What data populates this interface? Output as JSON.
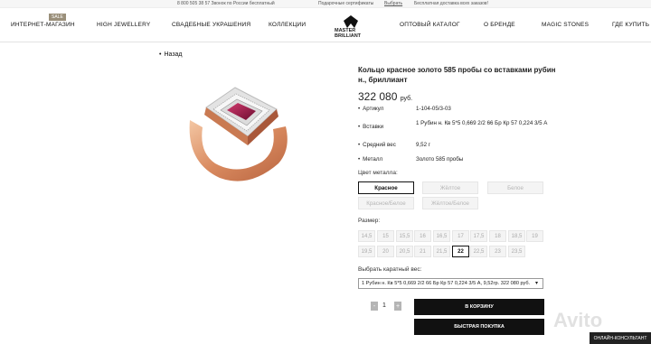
{
  "topbar": {
    "phone": "8 800 505 38 57 Звонок по России бесплатный",
    "certificates": "Подарочные сертификаты",
    "choose": "Выбрать",
    "delivery": "Бесплатная доставка всех заказов!"
  },
  "nav": {
    "sale_badge": "SALE",
    "items": [
      "ИНТЕРНЕТ-МАГАЗИН",
      "HIGH JEWELLERY",
      "СВАДЕБНЫЕ УКРАШЕНИЯ",
      "КОЛЛЕКЦИИ",
      "ОПТОВЫЙ КАТАЛОГ",
      "О БРЕНДЕ",
      "MAGIC STONES",
      "ГДЕ КУПИТЬ"
    ],
    "logo_line1": "MASTER",
    "logo_line2": "BRILLIANT"
  },
  "back_label": "Назад",
  "product": {
    "title": "Кольцо красное золото 585 пробы со вставками рубин н., бриллиант",
    "price": "322 080",
    "currency": "руб.",
    "specs": [
      {
        "label": "Артикул",
        "value": "1-104-05/3-03"
      },
      {
        "label": "Вставки",
        "value": "1 Рубин н. Кв 5*5 0,669 2/2 66 Бр Кр 57 0,224 3/5 А"
      },
      {
        "label": "Средний вес",
        "value": "9,52 г"
      },
      {
        "label": "Металл",
        "value": "Золото 585 пробы"
      }
    ]
  },
  "metal": {
    "label": "Цвет металла:",
    "options": [
      "Красное",
      "Жёлтое",
      "Белое",
      "Красное/Белое",
      "Жёлтое/Белое"
    ],
    "selected": "Красное"
  },
  "sizes": {
    "label": "Размер:",
    "row1": [
      "14,5",
      "15",
      "15,5",
      "16",
      "16,5",
      "17",
      "17,5",
      "18",
      "18,5",
      "19"
    ],
    "row2": [
      "19,5",
      "20",
      "20,5",
      "21",
      "21,5",
      "22",
      "22,5",
      "23",
      "23,5"
    ],
    "selected": "22"
  },
  "carat": {
    "label": "Выбрать каратный вес:",
    "value": "1 Рубин н. Кв 5*5 0,669 2/2 66 Бр Кр 57 0,224 3/5 А,   9,52гр.   322 080 руб."
  },
  "quantity": {
    "minus": "-",
    "value": "1",
    "plus": "+"
  },
  "buttons": {
    "cart": "В КОРЗИНУ",
    "quick": "БЫСТРАЯ ПОКУПКА"
  },
  "watermark": "Avito",
  "consultant": "ОНЛАЙН-КОНСУЛЬТАНТ",
  "colors": {
    "accent": "#111111",
    "ruby": "#9b1f4a",
    "gold": "#e0a07a"
  }
}
